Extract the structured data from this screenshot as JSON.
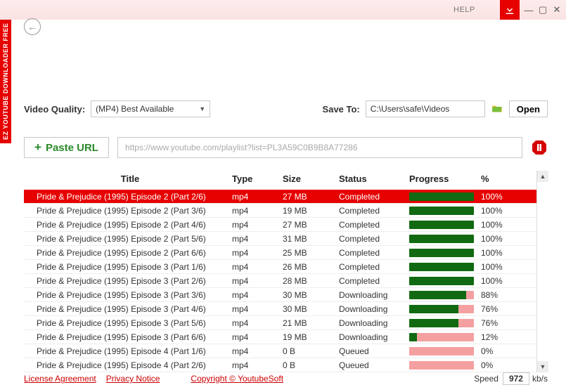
{
  "titlebar": {
    "help": "HELP"
  },
  "sidetab": "EZ YOUTUBE DOWNLOADER FREE",
  "controls": {
    "quality_label": "Video Quality:",
    "quality_value": "(MP4) Best Available",
    "saveto_label": "Save To:",
    "saveto_path": "C:\\Users\\safe\\Videos",
    "open_label": "Open",
    "paste_label": "Paste URL",
    "url_placeholder": "https://www.youtube.com/playlist?list=PL3A59C0B9B8A77286"
  },
  "table": {
    "headers": {
      "title": "Title",
      "type": "Type",
      "size": "Size",
      "status": "Status",
      "progress": "Progress",
      "pct": "%"
    },
    "rows": [
      {
        "title": "Pride & Prejudice (1995) Episode 2 (Part 2/6)",
        "type": "mp4",
        "size": "27 MB",
        "status": "Completed",
        "pct": "100%",
        "p": 100,
        "sel": true
      },
      {
        "title": "Pride & Prejudice (1995) Episode 2 (Part 3/6)",
        "type": "mp4",
        "size": "19 MB",
        "status": "Completed",
        "pct": "100%",
        "p": 100
      },
      {
        "title": "Pride & Prejudice (1995) Episode 2 (Part 4/6)",
        "type": "mp4",
        "size": "27 MB",
        "status": "Completed",
        "pct": "100%",
        "p": 100
      },
      {
        "title": "Pride & Prejudice (1995) Episode 2 (Part 5/6)",
        "type": "mp4",
        "size": "31 MB",
        "status": "Completed",
        "pct": "100%",
        "p": 100
      },
      {
        "title": "Pride & Prejudice (1995) Episode 2 (Part 6/6)",
        "type": "mp4",
        "size": "25 MB",
        "status": "Completed",
        "pct": "100%",
        "p": 100
      },
      {
        "title": "Pride & Prejudice (1995) Episode 3 (Part 1/6)",
        "type": "mp4",
        "size": "26 MB",
        "status": "Completed",
        "pct": "100%",
        "p": 100
      },
      {
        "title": "Pride & Prejudice (1995) Episode 3 (Part 2/6)",
        "type": "mp4",
        "size": "28 MB",
        "status": "Completed",
        "pct": "100%",
        "p": 100
      },
      {
        "title": "Pride & Prejudice (1995) Episode 3 (Part 3/6)",
        "type": "mp4",
        "size": "30 MB",
        "status": "Downloading",
        "pct": "88%",
        "p": 88
      },
      {
        "title": "Pride & Prejudice (1995) Episode 3 (Part 4/6)",
        "type": "mp4",
        "size": "30 MB",
        "status": "Downloading",
        "pct": "76%",
        "p": 76
      },
      {
        "title": "Pride & Prejudice (1995) Episode 3 (Part 5/6)",
        "type": "mp4",
        "size": "21 MB",
        "status": "Downloading",
        "pct": "76%",
        "p": 76
      },
      {
        "title": "Pride & Prejudice (1995) Episode 3 (Part 6/6)",
        "type": "mp4",
        "size": "19 MB",
        "status": "Downloading",
        "pct": "12%",
        "p": 12
      },
      {
        "title": "Pride & Prejudice (1995) Episode 4 (Part 1/6)",
        "type": "mp4",
        "size": "0 B",
        "status": "Queued",
        "pct": "0%",
        "p": 0
      },
      {
        "title": "Pride & Prejudice (1995) Episode 4 (Part 2/6)",
        "type": "mp4",
        "size": "0 B",
        "status": "Queued",
        "pct": "0%",
        "p": 0
      }
    ]
  },
  "footer": {
    "license": "License Agreement",
    "privacy": "Privacy Notice",
    "copyright": "Copyright © YoutubeSoft",
    "speed_label": "Speed",
    "speed_value": "972",
    "speed_unit": "kb/s"
  }
}
